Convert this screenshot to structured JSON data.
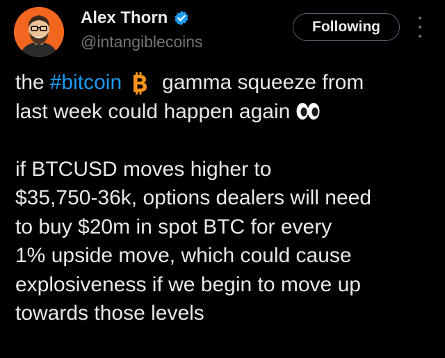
{
  "author": {
    "display_name": "Alex Thorn",
    "handle": "@intangiblecoins",
    "verified": true,
    "avatar_bg": "#f2661f"
  },
  "follow_button": {
    "label": "Following"
  },
  "menu": {
    "icon": "more-vertical-icon"
  },
  "tweet": {
    "line1_before": "the",
    "hashtag": "#bitcoin",
    "emoji_btc": "bitcoin-emoji",
    "line1_after": "gamma squeeze from",
    "line2": "last week could happen again",
    "emoji_eyes": "eyes-emoji",
    "para2_lines": [
      "if BTCUSD moves higher to",
      "$35,750-36k, options dealers will need",
      "to buy $20m in spot BTC for every",
      "1% upside move, which could cause",
      "explosiveness if we begin to move up",
      "towards those levels"
    ]
  },
  "colors": {
    "background": "#000000",
    "text": "#e7e9ea",
    "secondary": "#71767b",
    "accent": "#1d9bf0",
    "bitcoin_orange": "#f7931a"
  }
}
